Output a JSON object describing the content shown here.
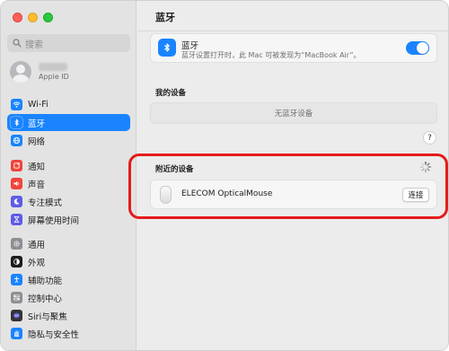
{
  "window": {
    "title": "蓝牙"
  },
  "sidebar": {
    "search_placeholder": "搜索",
    "account": {
      "subtitle": "Apple ID"
    },
    "items": [
      {
        "label": "Wi-Fi",
        "icon": "wifi-icon",
        "color": "#1a84ff"
      },
      {
        "label": "蓝牙",
        "icon": "bluetooth-icon",
        "color": "#1a84ff",
        "active": true
      },
      {
        "label": "网络",
        "icon": "globe-icon",
        "color": "#1a84ff"
      },
      {
        "label": "通知",
        "icon": "bell-icon",
        "color": "#f0443a"
      },
      {
        "label": "声音",
        "icon": "speaker-icon",
        "color": "#f0443a"
      },
      {
        "label": "专注模式",
        "icon": "moon-icon",
        "color": "#5e5ce6"
      },
      {
        "label": "屏幕使用时间",
        "icon": "hourglass-icon",
        "color": "#5e5ce6"
      },
      {
        "label": "通用",
        "icon": "gear-icon",
        "color": "#8e8e93"
      },
      {
        "label": "外观",
        "icon": "appearance-icon",
        "color": "#1d1d1f"
      },
      {
        "label": "辅助功能",
        "icon": "accessibility-icon",
        "color": "#1a84ff"
      },
      {
        "label": "控制中心",
        "icon": "control-center-icon",
        "color": "#8e8e93"
      },
      {
        "label": "Siri与聚焦",
        "icon": "siri-icon",
        "color": "#333333"
      },
      {
        "label": "隐私与安全性",
        "icon": "hand-icon",
        "color": "#1a84ff"
      }
    ]
  },
  "bluetooth": {
    "name": "蓝牙",
    "description": "蓝牙设置打开时，此 Mac 可被发现为“MacBook Air”。",
    "enabled": true
  },
  "my_devices": {
    "label": "我的设备",
    "empty_text": "无蓝牙设备"
  },
  "help_label": "?",
  "nearby": {
    "label": "附近的设备",
    "devices": [
      {
        "name": "ELECOM OpticalMouse",
        "action": "连接"
      }
    ]
  },
  "colors": {
    "accent": "#1a84ff",
    "highlight": "#e51b1b"
  }
}
